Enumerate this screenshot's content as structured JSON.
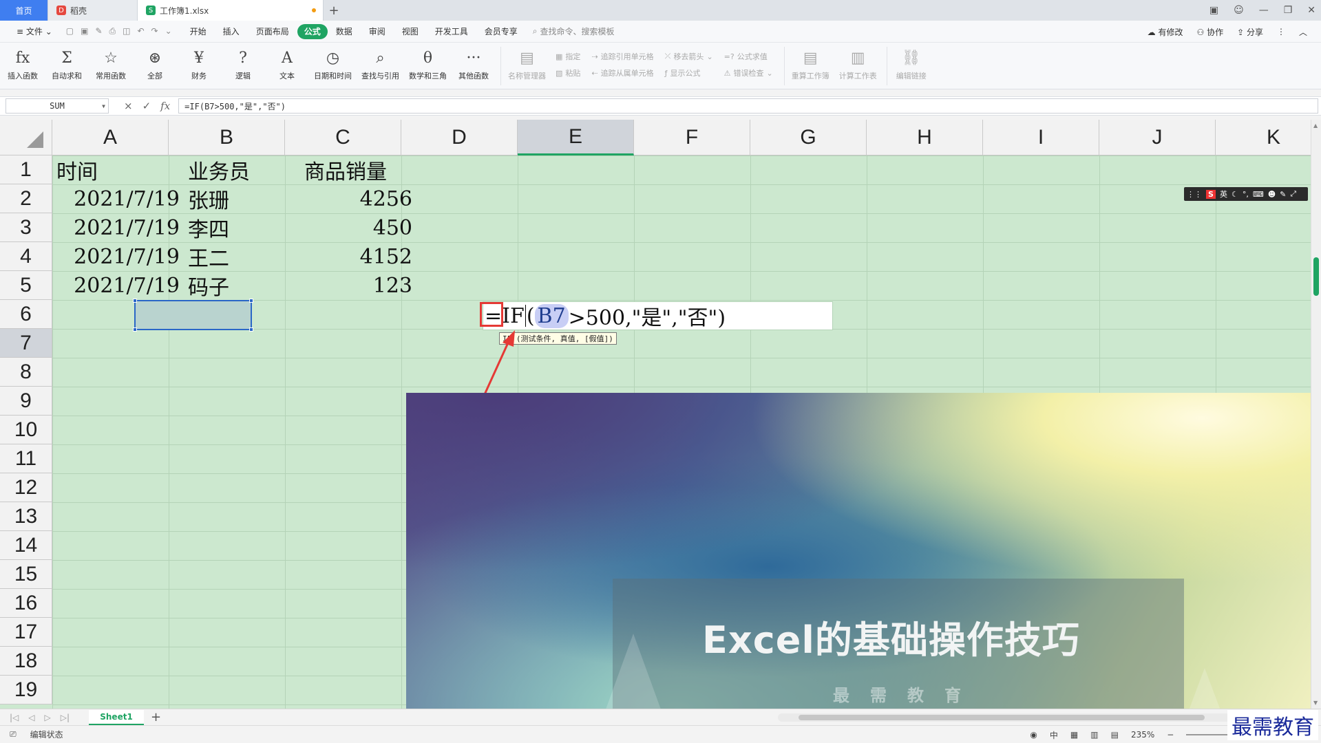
{
  "tabs": {
    "home": "首页",
    "daoke": "稻壳",
    "file": "工作簿1.xlsx",
    "add": "+"
  },
  "menu": {
    "file": "文件",
    "items": [
      "开始",
      "插入",
      "页面布局",
      "公式",
      "数据",
      "审阅",
      "视图",
      "开发工具",
      "会员专享"
    ],
    "active_index": 3,
    "search_placeholder": "查找命令、搜索模板",
    "modified": "有修改",
    "collab": "协作",
    "share": "分享"
  },
  "ribbon": {
    "buttons": [
      {
        "glyph": "fx",
        "label": "插入函数"
      },
      {
        "glyph": "Σ",
        "label": "自动求和"
      },
      {
        "glyph": "☆",
        "label": "常用函数"
      },
      {
        "glyph": "⊛",
        "label": "全部"
      },
      {
        "glyph": "¥",
        "label": "财务"
      },
      {
        "glyph": "?",
        "label": "逻辑"
      },
      {
        "glyph": "A",
        "label": "文本"
      },
      {
        "glyph": "◷",
        "label": "日期和时间"
      },
      {
        "glyph": "⌕",
        "label": "查找与引用"
      },
      {
        "glyph": "θ",
        "label": "数学和三角"
      },
      {
        "glyph": "···",
        "label": "其他函数"
      }
    ],
    "name_manager": "名称管理器",
    "specify": "指定",
    "paste": "粘贴",
    "trace_precedents": "追踪引用单元格",
    "trace_dependents": "追踪从属单元格",
    "remove_arrows": "移去箭头",
    "show_formulas": "显示公式",
    "eval_formula": "公式求值",
    "error_check": "错误检查",
    "recalc_book": "重算工作簿",
    "calc_sheet": "计算工作表",
    "edit_links": "编辑链接"
  },
  "formula_bar": {
    "name_box": "SUM",
    "formula": "=IF(B7>500,\"是\",\"否\")",
    "cancel": "×",
    "confirm": "✓",
    "fx": "fx"
  },
  "grid": {
    "columns": [
      "A",
      "B",
      "C",
      "D",
      "E",
      "F",
      "G",
      "H",
      "I",
      "J",
      "K"
    ],
    "rows": [
      "1",
      "2",
      "3",
      "4",
      "5",
      "6",
      "7",
      "8",
      "9",
      "10",
      "11",
      "12",
      "13",
      "14",
      "15",
      "16",
      "17",
      "18",
      "19"
    ],
    "headers": [
      "时间",
      "业务员",
      "商品销量"
    ],
    "data": [
      {
        "date": "2021/7/19",
        "name": "张珊",
        "qty": "4256"
      },
      {
        "date": "2021/7/19",
        "name": "李四",
        "qty": "450"
      },
      {
        "date": "2021/7/19",
        "name": "王二",
        "qty": "4152"
      },
      {
        "date": "2021/7/19",
        "name": "码子",
        "qty": "123"
      }
    ]
  },
  "editor": {
    "prefix": "=",
    "func": "IF",
    "open": "(",
    "ref": "B7",
    "rest": ">500,\"是\",\"否\")",
    "tooltip": "IF (测试条件, 真值, [假值])"
  },
  "overlay": {
    "title": "Excel的基础操作技巧",
    "subtitle": "最需教育"
  },
  "ime": {
    "mode": "英"
  },
  "sheets": {
    "active": "Sheet1",
    "add": "+"
  },
  "status": {
    "mode": "编辑状态",
    "input": "中",
    "zoom": "235%"
  },
  "watermark": "最需教育",
  "colors": {
    "accent": "#1fa463",
    "cell_bg": "#cce8cf",
    "selection": "#2a66c7",
    "highlight": "#e53935"
  }
}
